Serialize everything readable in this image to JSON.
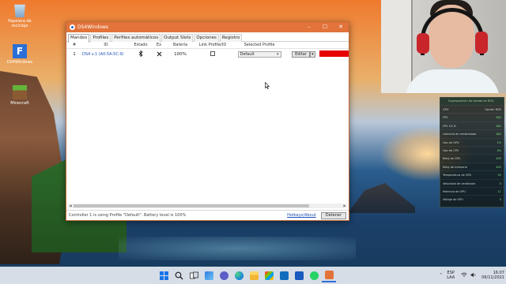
{
  "desktop": {
    "icons": [
      {
        "label": "Papelera de reciclaje"
      },
      {
        "label": "DS4Windows"
      },
      {
        "label": "Minecraft"
      }
    ]
  },
  "window": {
    "title": "DS4Windows",
    "controls": {
      "minimize": "–",
      "maximize": "☐",
      "close": "✕"
    },
    "tabs": [
      "Mandos",
      "Profiles",
      "Perfiles automáticos",
      "Output Slots",
      "Opciones",
      "Registro"
    ],
    "active_tab": "Mandos",
    "columns": [
      "#",
      "ID",
      "Estado",
      "Ex",
      "Batería",
      "Link Profile/ID",
      "Selected Profile"
    ],
    "controllers": [
      {
        "num": "1",
        "id": "DS4 v.1 (A0:5A:5C:9/",
        "status_icon": "bluetooth-icon",
        "exclusive_icon": "x-icon",
        "battery": "100%",
        "selected_profile": "Default",
        "edit_label": "Editar",
        "lightbar_color": "#e60000"
      }
    ],
    "status": {
      "message": "Controller 1 is using Profile \"Default\". Battery level is 100%",
      "hotkeys_label": "Hotkeys/About",
      "stop_label": "Detener"
    }
  },
  "perf_overlay": {
    "title": "Superposición de estado de ROG",
    "header_left": "GPU",
    "header_right": "Opción RDS",
    "rows": [
      {
        "label": "FPS",
        "value": "N/D"
      },
      {
        "label": "FPS 1% B.",
        "value": "N/D"
      },
      {
        "label": "Latencia de renderizado",
        "value": "N/D"
      },
      {
        "label": "Uso de GPU",
        "value": "1%"
      },
      {
        "label": "Uso de CPU",
        "value": "4%"
      },
      {
        "label": "Reloj de GPU",
        "value": "405"
      },
      {
        "label": "Reloj de memoria",
        "value": "405"
      },
      {
        "label": "Temperatura de GPU",
        "value": "50"
      },
      {
        "label": "Velocidad de ventilador",
        "value": "0"
      },
      {
        "label": "Potencia de GPU",
        "value": "11"
      },
      {
        "label": "Voltaje de GPU",
        "value": "0"
      }
    ]
  },
  "taskbar": {
    "apps": [
      "start-icon",
      "search-icon",
      "task-view-icon",
      "widgets-icon",
      "chat-icon",
      "edge-icon",
      "explorer-icon",
      "store-icon",
      "mail-icon",
      "word-icon",
      "whatsapp-icon",
      "ds4windows-icon"
    ],
    "language": "ESP",
    "layout": "LAA",
    "time": "16:07",
    "date": "06/11/2021"
  }
}
